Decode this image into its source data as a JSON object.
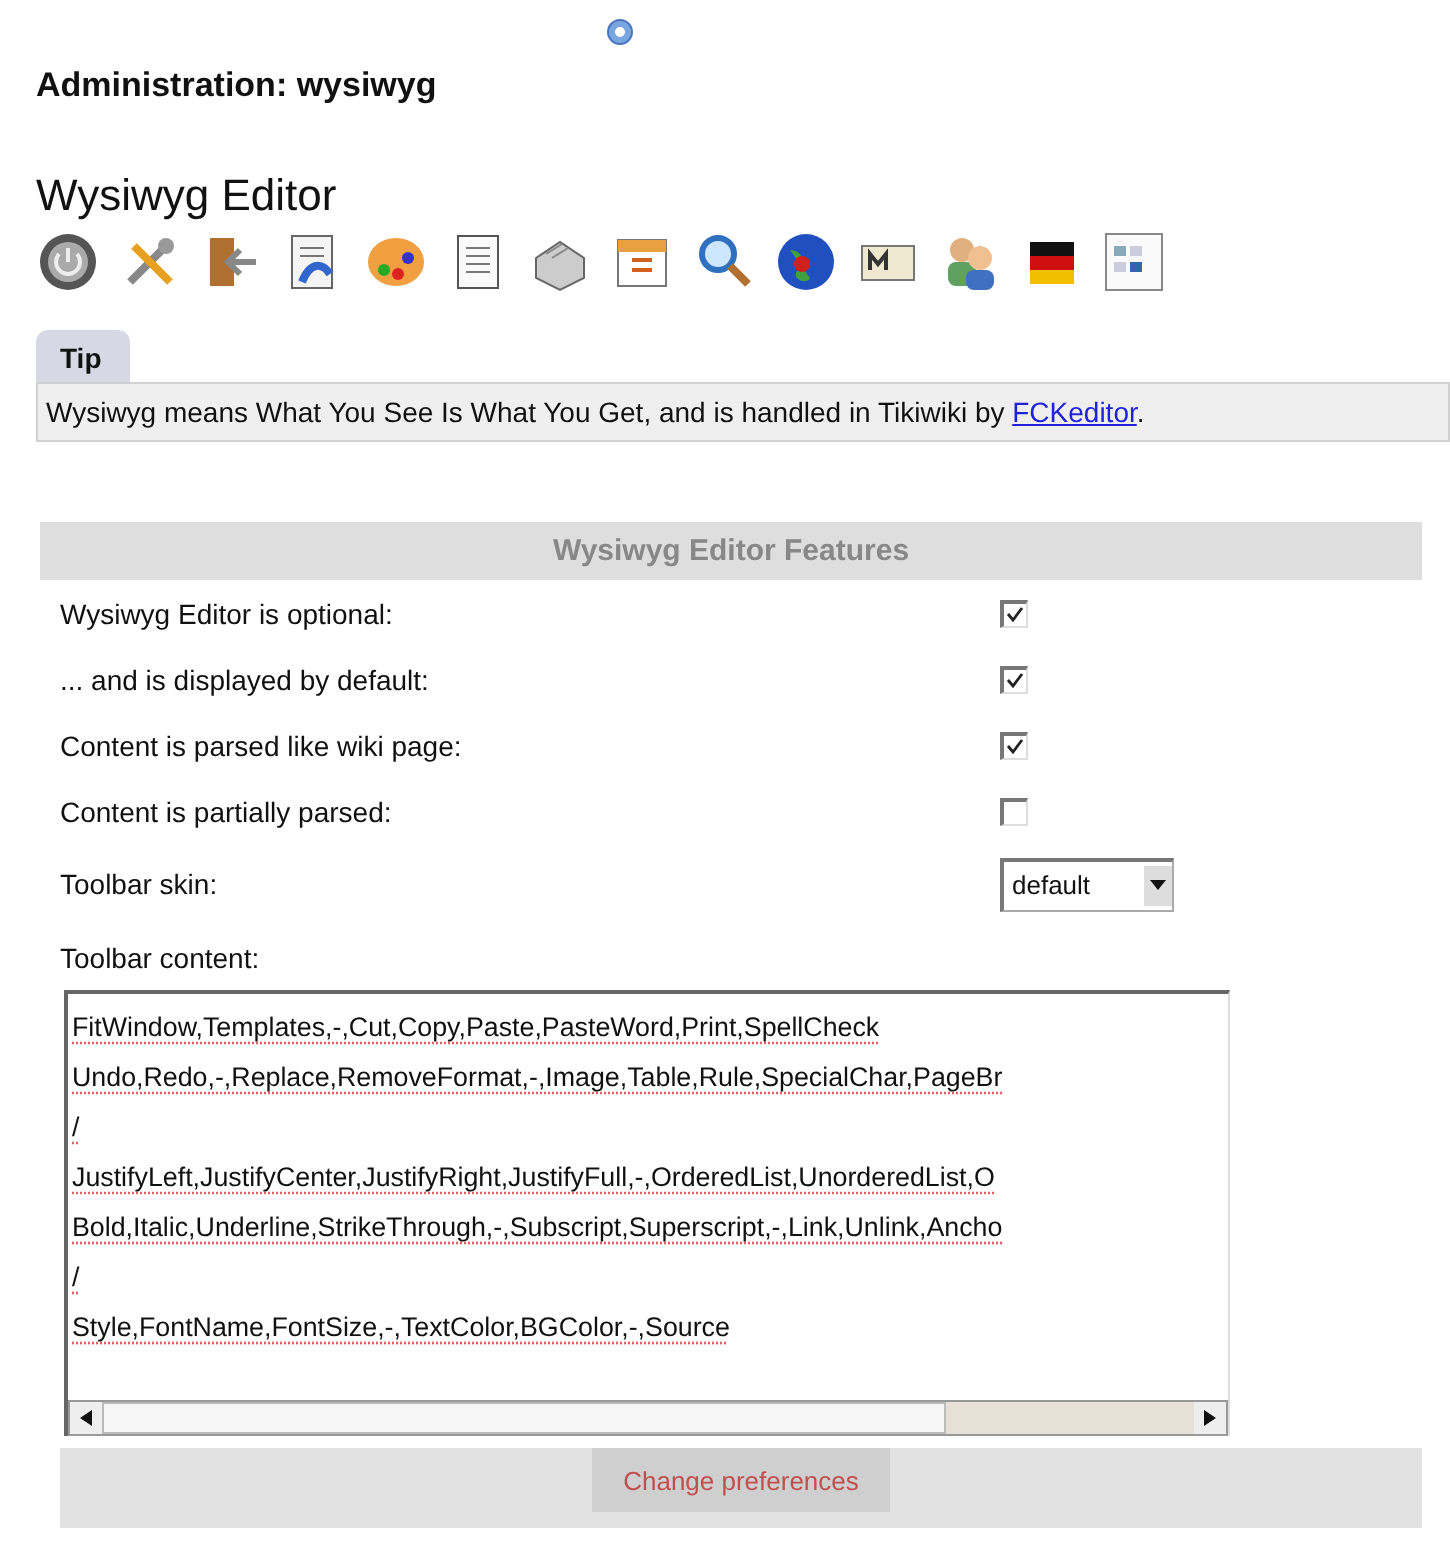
{
  "page_title": "Administration: wysiwyg",
  "section_title": "Wysiwyg Editor",
  "tip": {
    "label": "Tip",
    "text_before": "Wysiwyg means What You See Is What You Get, and is handled in Tikiwiki by ",
    "link": "FCKeditor",
    "text_after": "."
  },
  "features": {
    "title": "Wysiwyg Editor Features",
    "rows": [
      {
        "kind": "checkbox",
        "label": "Wysiwyg Editor is optional:",
        "checked": true
      },
      {
        "kind": "checkbox",
        "label": "... and is displayed by default:",
        "checked": true
      },
      {
        "kind": "checkbox",
        "label": "Content is parsed like wiki page:",
        "checked": true
      },
      {
        "kind": "checkbox",
        "label": "Content is partially parsed:",
        "checked": false
      },
      {
        "kind": "select",
        "label": "Toolbar skin:",
        "value": "default"
      },
      {
        "kind": "textarea",
        "label": "Toolbar content:",
        "lines": [
          "FitWindow,Templates,-,Cut,Copy,Paste,PasteWord,Print,SpellCheck",
          "Undo,Redo,-,Replace,RemoveFormat,-,Image,Table,Rule,SpecialChar,PageBr",
          "/",
          "JustifyLeft,JustifyCenter,JustifyRight,JustifyFull,-,OrderedList,UnorderedList,O",
          "Bold,Italic,Underline,StrikeThrough,-,Subscript,Superscript,-,Link,Unlink,Ancho",
          "/",
          "Style,FontName,FontSize,-,TextColor,BGColor,-,Source"
        ]
      }
    ]
  },
  "submit": "Change preferences"
}
